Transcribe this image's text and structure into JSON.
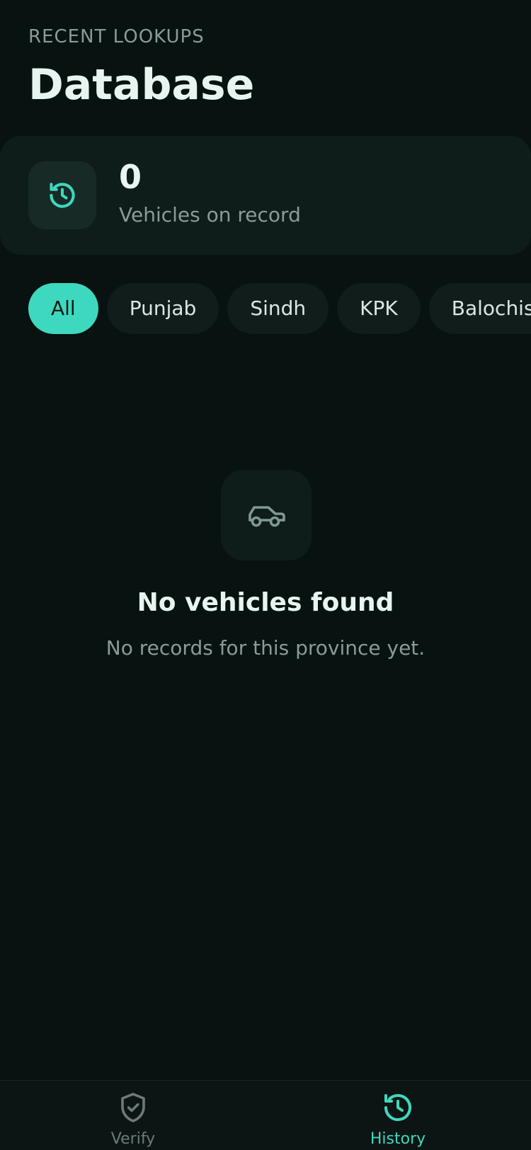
{
  "header": {
    "eyebrow": "RECENT LOOKUPS",
    "title": "Database"
  },
  "stats": {
    "icon": "history-icon",
    "count": "0",
    "label": "Vehicles on record"
  },
  "filters": {
    "items": [
      "All",
      "Punjab",
      "Sindh",
      "KPK",
      "Balochistan"
    ],
    "selected": "All"
  },
  "empty_state": {
    "icon": "car-icon",
    "title": "No vehicles found",
    "subtitle": "No records for this province yet."
  },
  "bottom_nav": {
    "items": [
      {
        "label": "Verify",
        "icon": "shield-check-icon",
        "active": false
      },
      {
        "label": "History",
        "icon": "history-icon",
        "active": true
      }
    ]
  },
  "colors": {
    "background": "#081210",
    "card": "#0f1d1a",
    "accent": "#3ed8be",
    "muted_text": "#8a9b96"
  }
}
